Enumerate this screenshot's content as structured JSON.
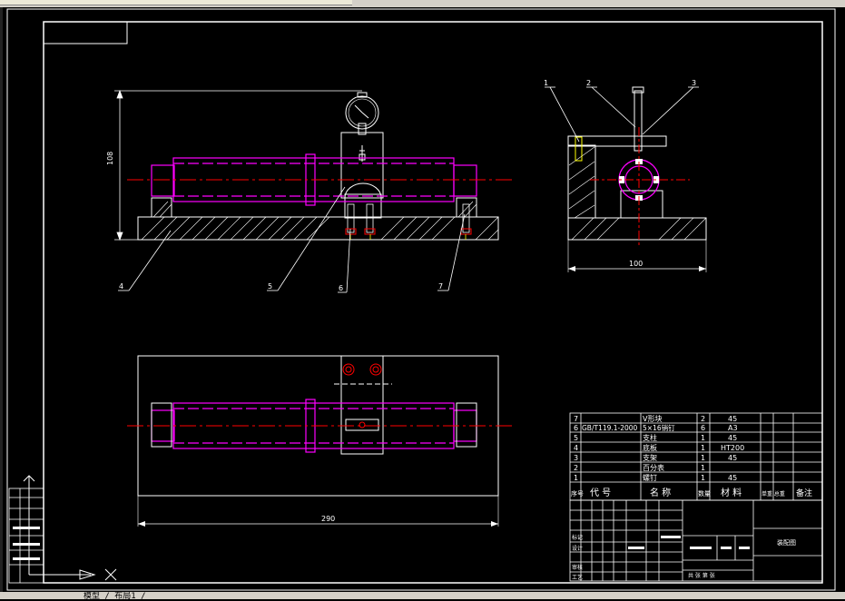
{
  "status": {
    "text": "模型 / 布局1 /"
  },
  "dimensions": {
    "height": "108",
    "base_width": "100",
    "plan_length": "290"
  },
  "leaders": {
    "l1": "1",
    "l2": "2",
    "l3": "3",
    "l4": "4",
    "l5": "5",
    "l6": "6",
    "l7": "7"
  },
  "bom": {
    "rows": [
      {
        "no": "7",
        "code": "",
        "name": "V形块",
        "qty": "2",
        "material": "45"
      },
      {
        "no": "6",
        "code": "GB/T119.1-2000",
        "name": "5×16销钉",
        "qty": "6",
        "material": "A3"
      },
      {
        "no": "5",
        "code": "",
        "name": "支柱",
        "qty": "1",
        "material": "45"
      },
      {
        "no": "4",
        "code": "",
        "name": "底板",
        "qty": "1",
        "material": "HT200"
      },
      {
        "no": "3",
        "code": "",
        "name": "支架",
        "qty": "1",
        "material": "45"
      },
      {
        "no": "2",
        "code": "",
        "name": "百分表",
        "qty": "1",
        "material": ""
      },
      {
        "no": "1",
        "code": "",
        "name": "螺钉",
        "qty": "1",
        "material": "45"
      }
    ],
    "header": {
      "no": "序号",
      "code": "代  号",
      "name": "名  称",
      "qty": "数量",
      "material": "材  料",
      "weight": "单重 总重",
      "note": "备注"
    }
  },
  "titleblock": {
    "title_cell": "装配图",
    "row_labels": [
      "标记",
      "设计",
      "审核",
      "工艺"
    ],
    "footer": "共 张 第 张"
  },
  "colors": {
    "line": "#ffffff",
    "part": "#ff00ff",
    "center": "#ff0000",
    "accent": "#ffff00"
  }
}
